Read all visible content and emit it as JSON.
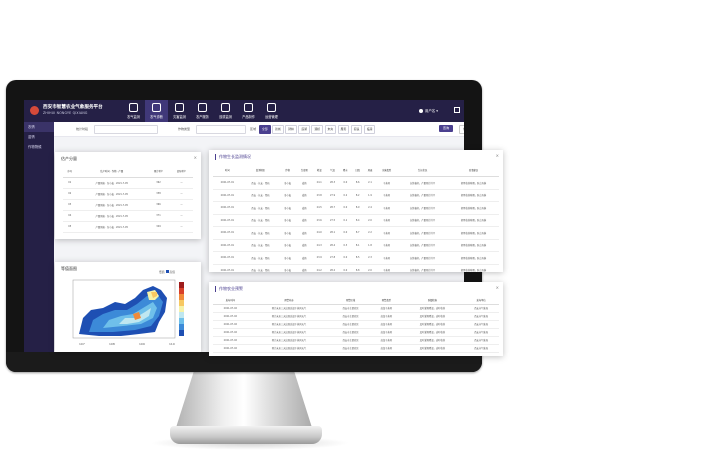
{
  "header": {
    "title": "西安市智慧农业气象服务平台",
    "subtitle": "ZHIHUI NONGYE QIXIANG",
    "nav": [
      {
        "label": "农气监测",
        "icon": "monitor-icon",
        "active": false
      },
      {
        "label": "农气诊断",
        "icon": "leaf-icon",
        "active": true
      },
      {
        "label": "灾害监测",
        "icon": "warning-icon",
        "active": false
      },
      {
        "label": "农产服务",
        "icon": "hand-icon",
        "active": false
      },
      {
        "label": "遥感监测",
        "icon": "satellite-icon",
        "active": false
      },
      {
        "label": "产品制作",
        "icon": "document-icon",
        "active": false
      },
      {
        "label": "运营管理",
        "icon": "chart-icon",
        "active": false
      }
    ],
    "user": "用户名"
  },
  "sidebar": {
    "items": [
      {
        "label": "农情",
        "active": true
      },
      {
        "label": "苗情",
        "active": false
      },
      {
        "label": "作物物候",
        "active": false
      }
    ]
  },
  "filters": {
    "date_label": "统计时段",
    "crop_label": "作物类型",
    "region_label": "区域",
    "tags": [
      "全部",
      "新城",
      "碑林",
      "莲湖",
      "灞桥",
      "未央",
      "雁塔",
      "阎良",
      "临潼"
    ],
    "query_label": "查询",
    "reset_label": "重置"
  },
  "panels": {
    "yield": {
      "title": "估产分量",
      "headers": [
        "序号",
        "估产时间 · 作物 · 产量",
        "预计单产",
        "实际单产"
      ],
      "rows": [
        [
          "01",
          "产量预报 · 冬小麦 · 2021-7-05",
          "362",
          "—"
        ],
        [
          "02",
          "产量预报 · 冬小麦 · 2021-7-05",
          "358",
          "—"
        ],
        [
          "03",
          "产量预报 · 冬小麦 · 2021-7-05",
          "366",
          "—"
        ],
        [
          "04",
          "产量预报 · 冬小麦 · 2021-7-05",
          "371",
          "—"
        ],
        [
          "05",
          "产量预报 · 冬小麦 · 2021-7-05",
          "349",
          "—"
        ]
      ]
    },
    "map": {
      "title": "等值面图",
      "legend": [
        "低值",
        "高值"
      ],
      "ticks": [
        "107",
        "108",
        "109",
        "110"
      ]
    },
    "monitor": {
      "title": "作物生长监测情况",
      "headers": [
        "时间",
        "监测地区",
        "作物",
        "生育期",
        "地温",
        "气温",
        "降水",
        "日照",
        "风速",
        "灾害类型",
        "生长状况",
        "农事建议"
      ],
      "rows": [
        [
          "2021-07-01",
          "西安 · 长安 · 鄠邑",
          "冬小麦",
          "成熟",
          "24.1",
          "28.3",
          "0.0",
          "8.6",
          "2.1",
          "干热风",
          "长势偏好，产量预计持平",
          "抓紧收获晾晒，防止雨淋"
        ],
        [
          "2021-07-01",
          "西安 · 长安 · 鄠邑",
          "冬小麦",
          "成熟",
          "23.8",
          "27.9",
          "0.2",
          "8.2",
          "1.9",
          "干热风",
          "长势偏好，产量预计持平",
          "抓紧收获晾晒，防止雨淋"
        ],
        [
          "2021-07-01",
          "西安 · 长安 · 鄠邑",
          "冬小麦",
          "成熟",
          "24.5",
          "28.7",
          "0.0",
          "8.9",
          "2.4",
          "干热风",
          "长势偏好，产量预计持平",
          "抓紧收获晾晒，防止雨淋"
        ],
        [
          "2021-07-01",
          "西安 · 长安 · 鄠邑",
          "冬小麦",
          "成熟",
          "23.6",
          "27.5",
          "0.1",
          "8.4",
          "2.0",
          "干热风",
          "长势偏好，产量预计持平",
          "抓紧收获晾晒，防止雨淋"
        ],
        [
          "2021-07-01",
          "西安 · 长安 · 鄠邑",
          "冬小麦",
          "成熟",
          "24.0",
          "28.1",
          "0.0",
          "8.7",
          "2.2",
          "干热风",
          "长势偏好，产量预计持平",
          "抓紧收获晾晒，防止雨淋"
        ],
        [
          "2021-07-01",
          "西安 · 长安 · 鄠邑",
          "冬小麦",
          "成熟",
          "24.3",
          "28.4",
          "0.3",
          "8.1",
          "1.8",
          "干热风",
          "长势偏好，产量预计持平",
          "抓紧收获晾晒，防止雨淋"
        ],
        [
          "2021-07-01",
          "西安 · 长安 · 鄠邑",
          "冬小麦",
          "成熟",
          "23.9",
          "27.8",
          "0.0",
          "8.5",
          "2.3",
          "干热风",
          "长势偏好，产量预计持平",
          "抓紧收获晾晒，防止雨淋"
        ],
        [
          "2021-07-01",
          "西安 · 长安 · 鄠邑",
          "冬小麦",
          "成熟",
          "24.2",
          "28.2",
          "0.0",
          "8.8",
          "2.0",
          "干热风",
          "长势偏好，产量预计持平",
          "抓紧收获晾晒，防止雨淋"
        ]
      ]
    },
    "warning": {
      "title": "作物农业预警",
      "headers": [
        "发布时间",
        "预警内容",
        "预警区域",
        "预警类型",
        "防御指南",
        "发布单位"
      ],
      "rows": [
        [
          "2021-07-02",
          "预计未来三天出现高温干热风天气",
          "西安市主要农区",
          "高温干热风",
          "及时灌溉降温，适时收获",
          "西安市气象局"
        ],
        [
          "2021-07-02",
          "预计未来三天出现高温干热风天气",
          "西安市主要农区",
          "高温干热风",
          "及时灌溉降温，适时收获",
          "西安市气象局"
        ],
        [
          "2021-07-02",
          "预计未来三天出现高温干热风天气",
          "西安市主要农区",
          "高温干热风",
          "及时灌溉降温，适时收获",
          "西安市气象局"
        ],
        [
          "2021-07-02",
          "预计未来三天出现高温干热风天气",
          "西安市主要农区",
          "高温干热风",
          "及时灌溉降温，适时收获",
          "西安市气象局"
        ],
        [
          "2021-07-02",
          "预计未来三天出现高温干热风天气",
          "西安市主要农区",
          "高温干热风",
          "及时灌溉降温，适时收获",
          "西安市气象局"
        ],
        [
          "2021-07-02",
          "预计未来三天出现高温干热风天气",
          "西安市主要农区",
          "高温干热风",
          "及时灌溉降温，适时收获",
          "西安市气象局"
        ]
      ]
    }
  },
  "colors": {
    "header_bg": "#252046",
    "accent": "#4a3f8f",
    "map_colors": [
      "#1e4fb3",
      "#3c8ad8",
      "#6fc0ea",
      "#bfe7f0",
      "#f6f2a8",
      "#f7c862",
      "#f08a3a",
      "#d8402a",
      "#9e1c1c"
    ]
  }
}
